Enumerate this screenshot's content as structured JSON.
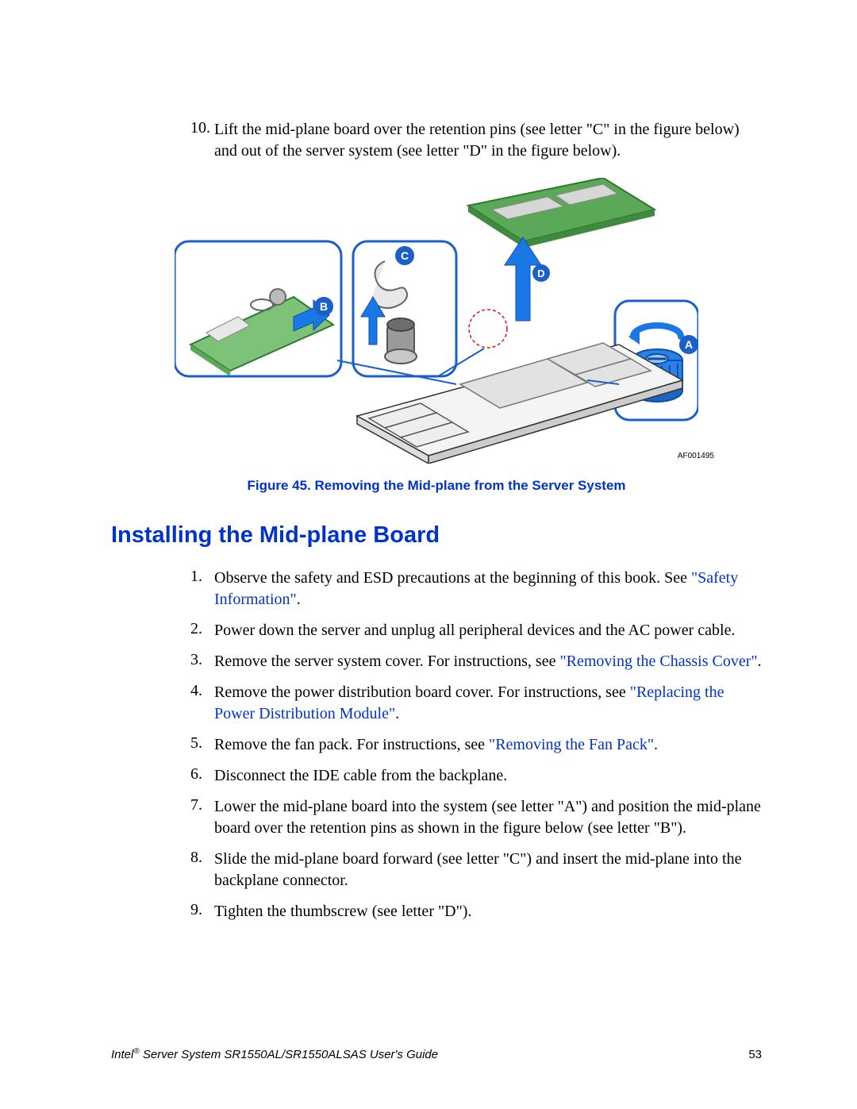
{
  "top_step": {
    "number": "10.",
    "text_before": "Lift the mid-plane board over the retention pins (see letter \"C\" in the figure below) and out of the server system (see letter \"D\" in the figure below)."
  },
  "figure": {
    "id": "AF001495",
    "caption": "Figure 45. Removing the Mid-plane from the Server System",
    "callouts": {
      "a": "A",
      "b": "B",
      "c": "C",
      "d": "D"
    }
  },
  "section_heading": "Installing the Mid-plane Board",
  "steps": [
    {
      "n": "1.",
      "parts": [
        {
          "t": "Observe the safety and ESD precautions at the beginning of this book. See "
        },
        {
          "t": "\"Safety Information\"",
          "link": true
        },
        {
          "t": "."
        }
      ]
    },
    {
      "n": "2.",
      "parts": [
        {
          "t": "Power down the server and unplug all peripheral devices and the AC power cable."
        }
      ]
    },
    {
      "n": "3.",
      "parts": [
        {
          "t": "Remove the server system cover. For instructions, see "
        },
        {
          "t": "\"Removing the Chassis Cover\"",
          "link": true
        },
        {
          "t": "."
        }
      ]
    },
    {
      "n": "4.",
      "parts": [
        {
          "t": "Remove the power distribution board cover. For instructions, see "
        },
        {
          "t": "\"Replacing the Power Distribution Module\"",
          "link": true
        },
        {
          "t": "."
        }
      ]
    },
    {
      "n": "5.",
      "parts": [
        {
          "t": "Remove the fan pack. For instructions, see "
        },
        {
          "t": "\"Removing the Fan Pack\"",
          "link": true
        },
        {
          "t": "."
        }
      ]
    },
    {
      "n": "6.",
      "parts": [
        {
          "t": "Disconnect the IDE cable from the backplane."
        }
      ]
    },
    {
      "n": "7.",
      "parts": [
        {
          "t": "Lower the mid-plane board into the system (see letter \"A\") and position the mid-plane board over the retention pins as shown in the figure below (see letter \"B\")."
        }
      ]
    },
    {
      "n": "8.",
      "parts": [
        {
          "t": "Slide the mid-plane board forward (see letter \"C\") and insert the mid-plane into the backplane connector."
        }
      ]
    },
    {
      "n": "9.",
      "parts": [
        {
          "t": "Tighten the thumbscrew (see letter \"D\")."
        }
      ]
    }
  ],
  "footer": {
    "brand": "Intel",
    "reg": "®",
    "title": " Server System SR1550AL/SR1550ALSAS User's Guide",
    "page": "53"
  }
}
